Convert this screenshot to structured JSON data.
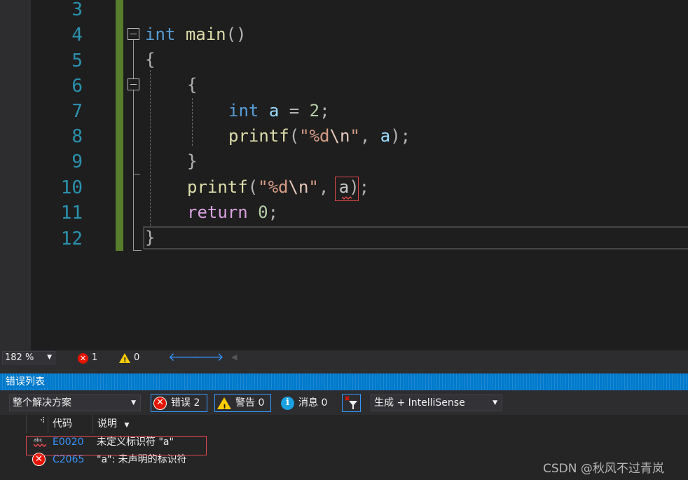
{
  "editor": {
    "line_numbers": [
      "3",
      "4",
      "5",
      "6",
      "7",
      "8",
      "9",
      "10",
      "11",
      "12"
    ],
    "lines": {
      "l4": {
        "kw": "int",
        "fn": "main",
        "punc": "()"
      },
      "l5": {
        "brace": "{"
      },
      "l6": {
        "brace": "{"
      },
      "l7": {
        "kw": "int",
        "var": "a",
        "op": " = ",
        "num": "2",
        "semi": ";"
      },
      "l8": {
        "fn": "printf",
        "open": "(",
        "str1": "\"%d",
        "esc": "\\n",
        "str2": "\"",
        "comma": ", ",
        "var": "a",
        "close": ");"
      },
      "l9": {
        "brace": "}"
      },
      "l10": {
        "fn": "printf",
        "open": "(",
        "str1": "\"%d",
        "esc": "\\n",
        "str2": "\"",
        "comma": ", ",
        "var": "a",
        "close": ");"
      },
      "l11": {
        "kw": "return",
        "num": "0",
        "semi": ";"
      },
      "l12": {
        "brace": "}"
      }
    }
  },
  "status": {
    "zoom": "182 %",
    "errors": "1",
    "warnings": "0"
  },
  "error_list": {
    "title": "错误列表",
    "scope": "整个解决方案",
    "errors_btn": "错误 2",
    "warnings_btn": "警告 0",
    "messages_btn": "消息 0",
    "build_filter": "生成 + IntelliSense",
    "columns": {
      "code": "代码",
      "desc": "说明"
    },
    "rows": [
      {
        "code": "E0020",
        "desc": "未定义标识符 \"a\""
      },
      {
        "code": "C2065",
        "desc": "\"a\": 未声明的标识符"
      }
    ]
  },
  "watermark": "CSDN @秋风不过青岚"
}
